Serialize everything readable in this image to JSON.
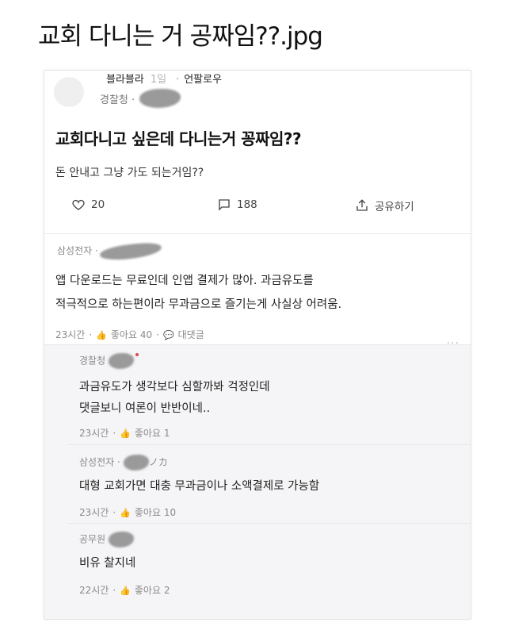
{
  "page_title": "교회 다니는 거 공짜임??.jpg",
  "post": {
    "author": "블라블라",
    "time": "1일",
    "follow_label": "언팔로우",
    "company": "경찰청",
    "title": "교회다니고 싶은데 다니는거 꽁짜임??",
    "body": "돈 안내고 그냥 가도 되는거임??",
    "likes": "20",
    "comments": "188",
    "share_label": "공유하기"
  },
  "comment": {
    "company": "삼성전자",
    "line1": "앱 다운로드는 무료인데 인앱 결제가 많아. 과금유도를",
    "line2": "적극적으로 하는편이라 무과금으로 즐기는게 사실상 어려움.",
    "time": "23시간",
    "likes_label": "좋아요 40",
    "reply_label": "대댓글",
    "more": "..."
  },
  "replies": [
    {
      "company": "경찰청",
      "line1": "과금유도가 생각보다 심할까봐 걱정인데",
      "line2": "댓글보니 여론이 반반이네..",
      "time": "23시간",
      "likes_label": "좋아요 1"
    },
    {
      "company": "삼성전자",
      "suffix": "ノカ",
      "line1": "대형 교회가면 대충 무과금이나 소액결제로 가능함",
      "time": "23시간",
      "likes_label": "좋아요 10"
    },
    {
      "company": "공무원",
      "line1": "비유 찰지네",
      "time": "22시간",
      "likes_label": "좋아요 2"
    }
  ],
  "icons": {
    "heart": "heart-icon",
    "comment": "comment-icon",
    "share": "share-icon",
    "thumb": "thumbs-up-icon",
    "reply": "reply-icon"
  },
  "colors": {
    "reply_bg": "#f5f5f7",
    "muted": "#8a8a8a",
    "badge_dot": "#e54848"
  }
}
